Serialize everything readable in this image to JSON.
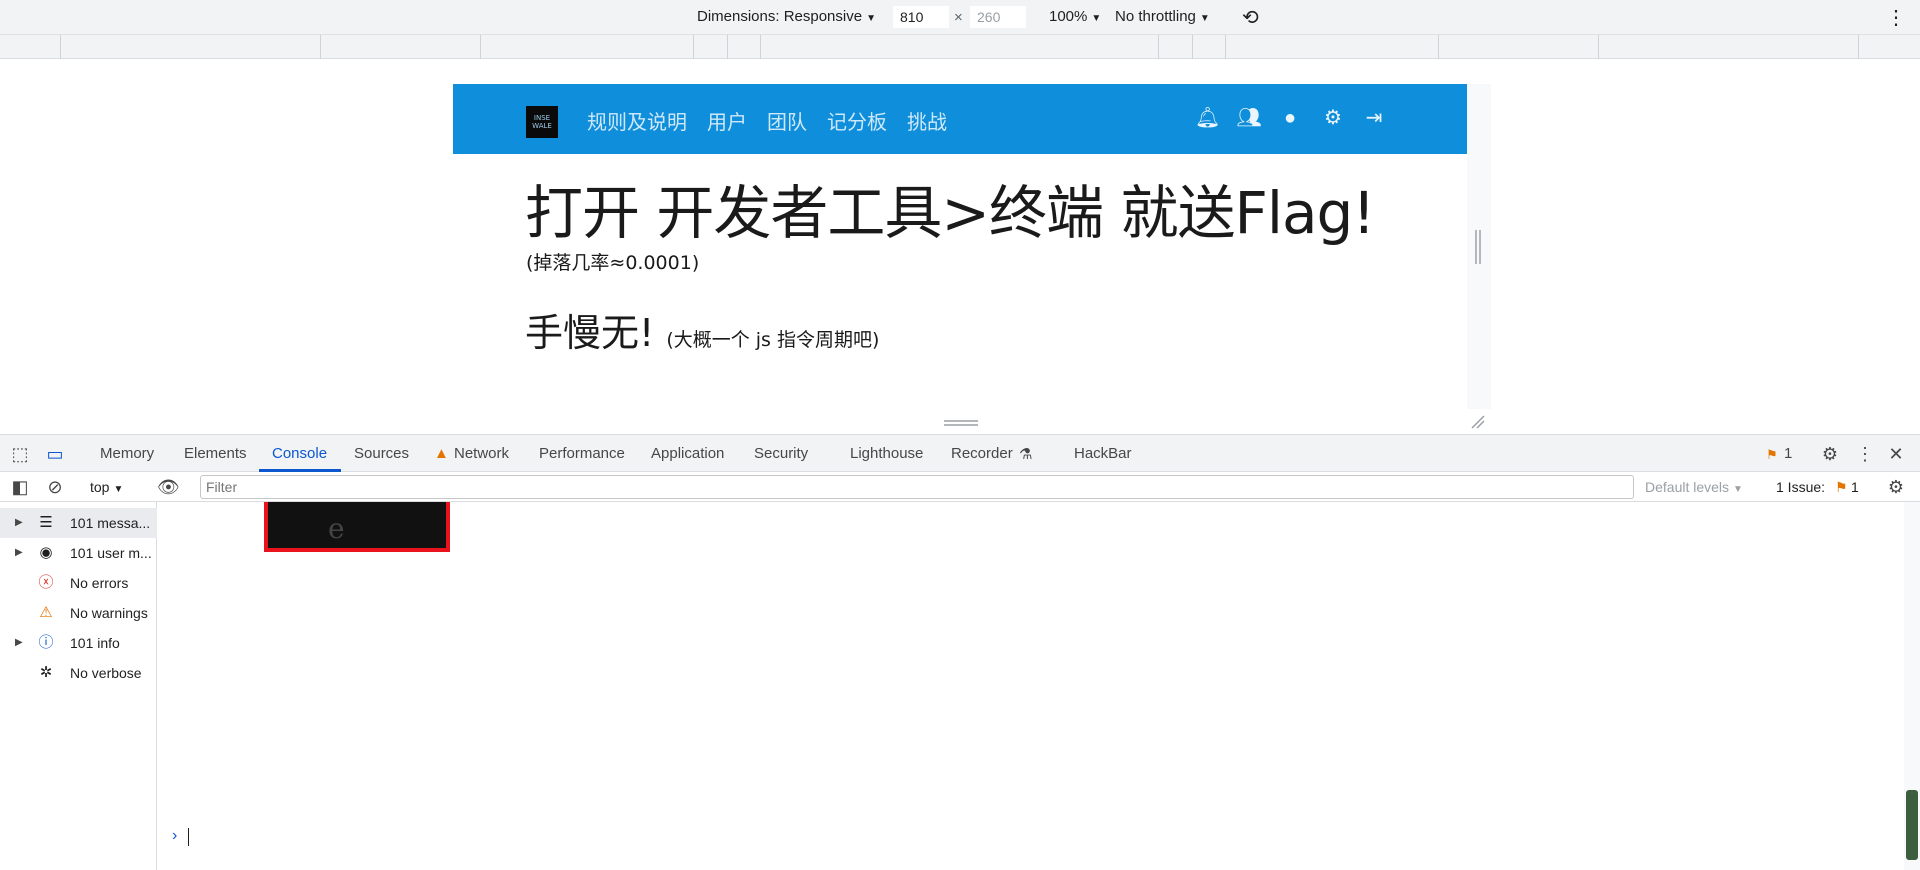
{
  "device_toolbar": {
    "dimensions_label": "Dimensions: Responsive",
    "width_value": "810",
    "height_placeholder": "260",
    "times_symbol": "×",
    "zoom": "100%",
    "throttling": "No throttling"
  },
  "site": {
    "logo_text": "INSE WALE",
    "nav_links": [
      "规则及说明",
      "用户",
      "团队",
      "记分板",
      "挑战"
    ],
    "heading": "打开 开发者工具>终端 就送Flag!",
    "drop_rate": "(掉落几率≈0.0001)",
    "subheading": "手慢无!",
    "subheading_note": "(大概一个 js 指令周期吧)"
  },
  "devtools": {
    "tabs": [
      "Memory",
      "Elements",
      "Console",
      "Sources",
      "Network",
      "Performance",
      "Application",
      "Security",
      "Lighthouse",
      "Recorder",
      "HackBar"
    ],
    "active_tab": "Console",
    "issues_badge_count": "1",
    "console_toolbar": {
      "context": "top",
      "filter_placeholder": "Filter",
      "default_levels": "Default levels",
      "issues_label": "1 Issue:",
      "issues_count": "1"
    },
    "sidebar": [
      {
        "label": "101 messa...",
        "icon": "list-icon",
        "expandable": true
      },
      {
        "label": "101 user m...",
        "icon": "user-icon",
        "expandable": true
      },
      {
        "label": "No errors",
        "icon": "error-icon",
        "expandable": false
      },
      {
        "label": "No warnings",
        "icon": "warning-icon",
        "expandable": false
      },
      {
        "label": "101 info",
        "icon": "info-icon",
        "expandable": true
      },
      {
        "label": "No verbose",
        "icon": "bug-icon",
        "expandable": false
      }
    ],
    "prompt_symbol": "›"
  },
  "colors": {
    "navbar": "#0f8fdb",
    "accent": "#0b57d0",
    "error": "#d93025",
    "warning": "#e37400"
  }
}
